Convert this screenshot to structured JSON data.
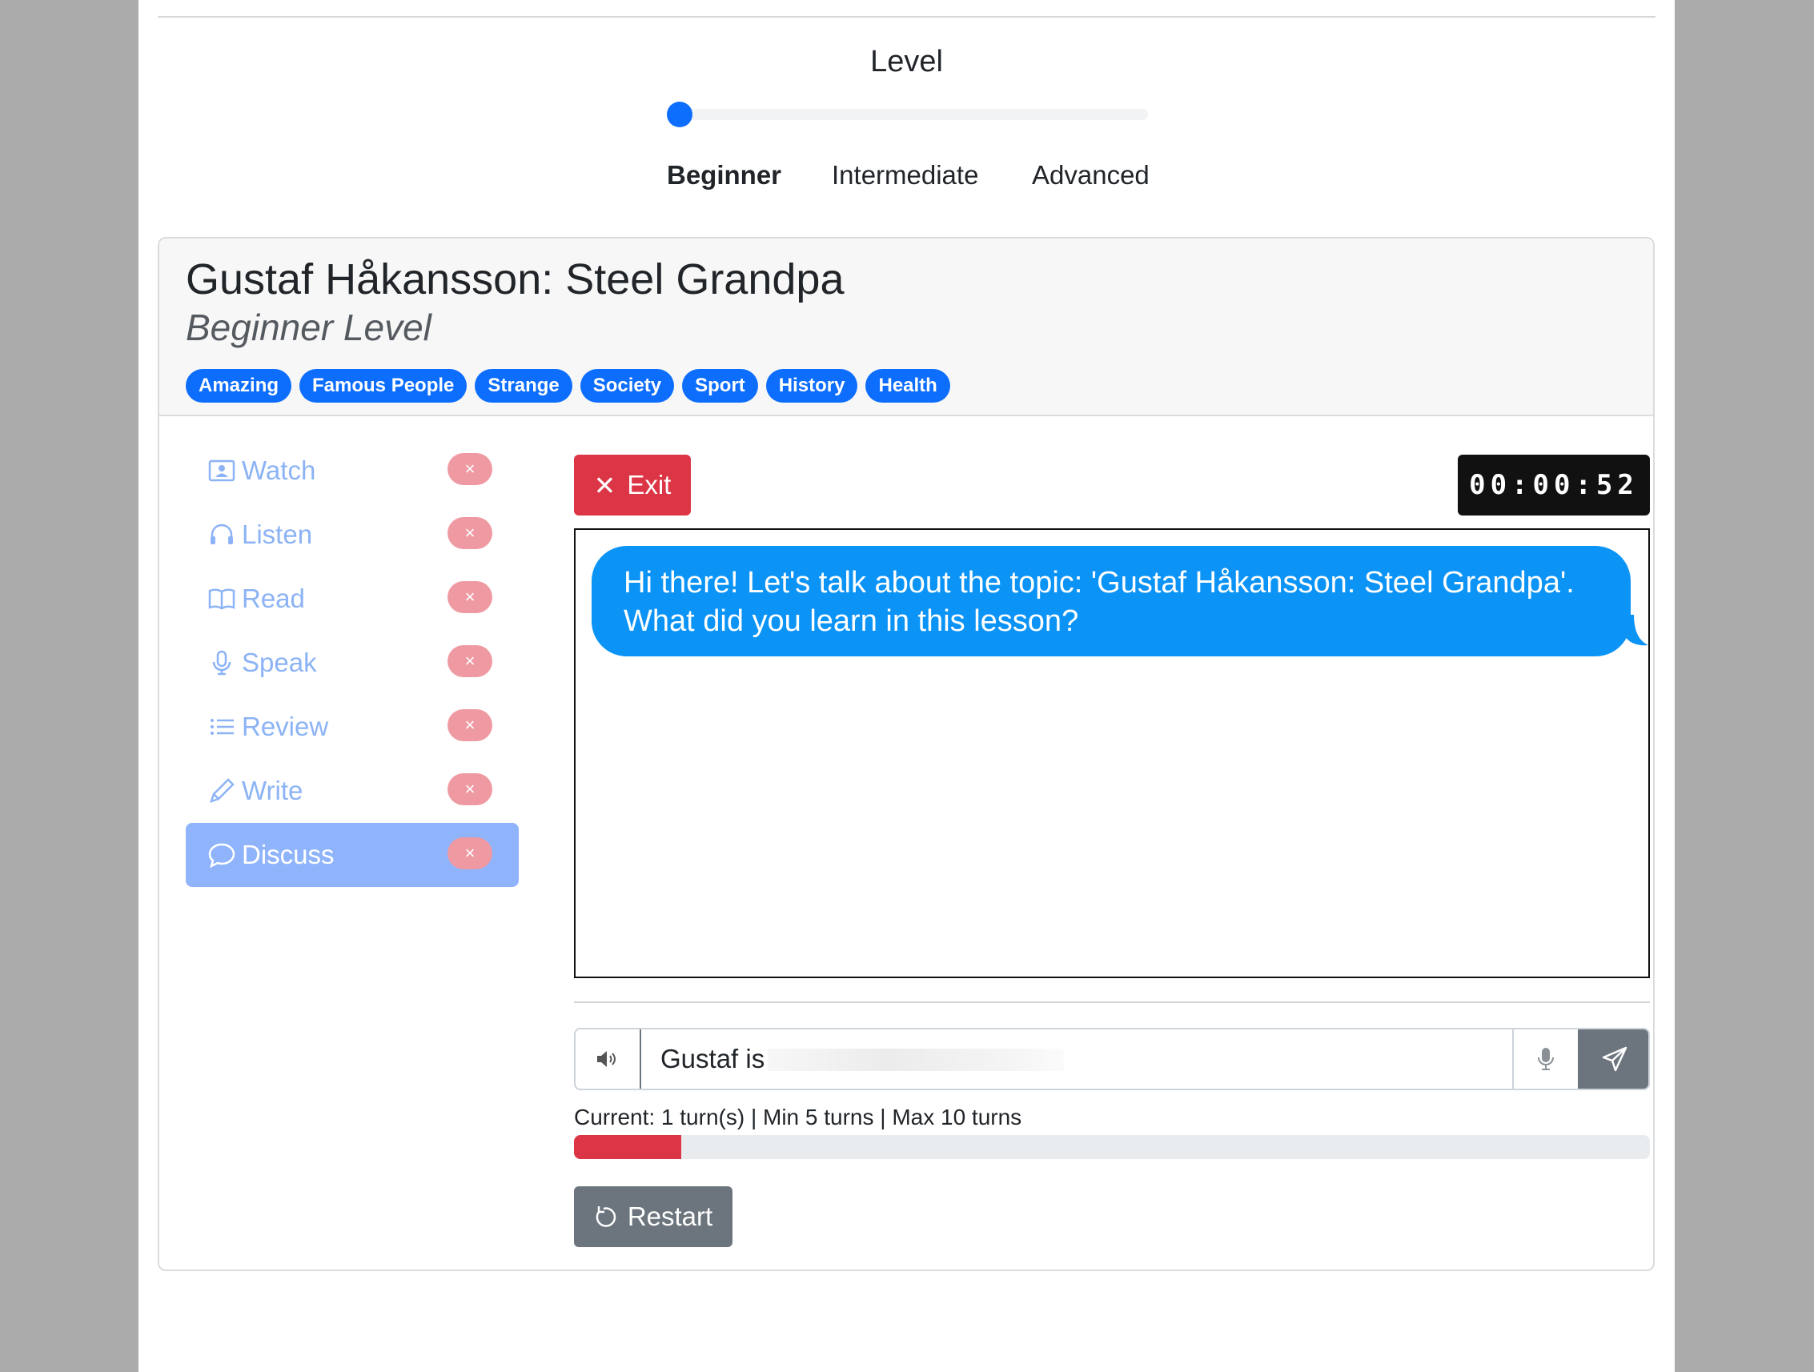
{
  "level": {
    "title": "Level",
    "value": 0,
    "options": [
      {
        "label": "Beginner",
        "active": true
      },
      {
        "label": "Intermediate",
        "active": false
      },
      {
        "label": "Advanced",
        "active": false
      }
    ]
  },
  "lesson": {
    "title": "Gustaf Håkansson: Steel Grandpa",
    "level_label": "Beginner Level",
    "tags": [
      "Amazing",
      "Famous People",
      "Strange",
      "Society",
      "Sport",
      "History",
      "Health"
    ]
  },
  "nav": {
    "items": [
      {
        "label": "Watch",
        "icon": "video-icon",
        "status": "×"
      },
      {
        "label": "Listen",
        "icon": "headphones-icon",
        "status": "×"
      },
      {
        "label": "Read",
        "icon": "book-icon",
        "status": "×"
      },
      {
        "label": "Speak",
        "icon": "microphone-icon",
        "status": "×"
      },
      {
        "label": "Review",
        "icon": "list-icon",
        "status": "×"
      },
      {
        "label": "Write",
        "icon": "pencil-icon",
        "status": "×"
      },
      {
        "label": "Discuss",
        "icon": "chat-icon",
        "status": "×",
        "active": true
      }
    ]
  },
  "discuss": {
    "exit_label": "Exit",
    "timer": "00:00:52",
    "messages": [
      {
        "from": "bot",
        "text": "Hi there! Let's talk about the topic: 'Gustaf Håkansson: Steel Grandpa'. What did you learn in this lesson?"
      }
    ],
    "input_value": "Gustaf is",
    "turns_label": "Current: 1 turn(s) | Min 5 turns | Max 10 turns",
    "progress_fraction": 0.1,
    "restart_label": "Restart"
  },
  "colors": {
    "primary": "#0d6efd",
    "danger": "#dc3545",
    "secondary": "#6c757d",
    "bubble": "#0b93f6"
  }
}
